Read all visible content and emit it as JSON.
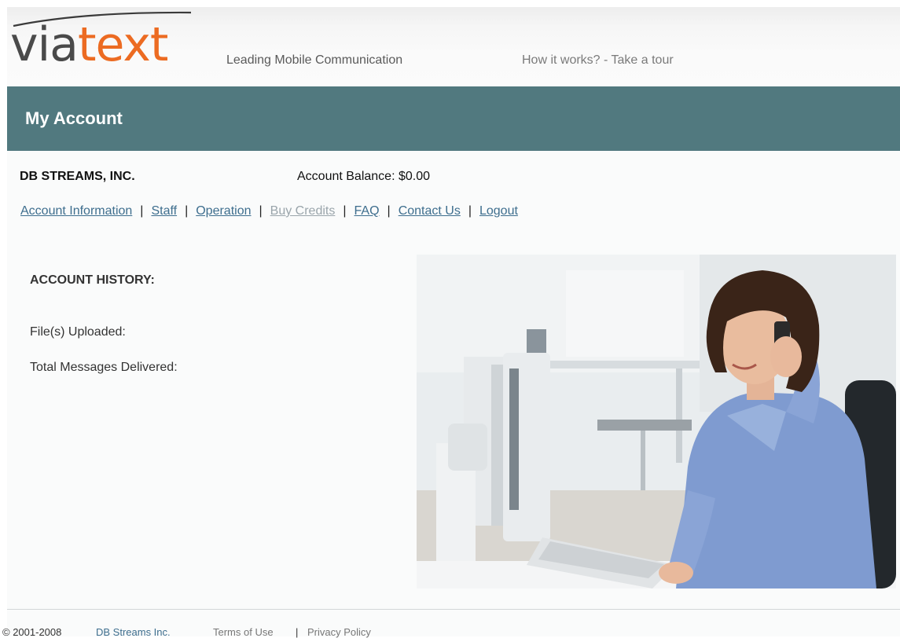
{
  "header": {
    "logo_part1": "via",
    "logo_part2": "text",
    "tagline": "Leading Mobile Communication",
    "tour_link": "How it works? - Take a tour"
  },
  "banner": {
    "title": "My Account"
  },
  "account": {
    "company": "DB STREAMS, INC.",
    "balance": "Account Balance: $0.00"
  },
  "nav": {
    "items": [
      {
        "label": "Account Information",
        "enabled": true
      },
      {
        "label": "Staff",
        "enabled": true
      },
      {
        "label": "Operation",
        "enabled": true
      },
      {
        "label": "Buy Credits",
        "enabled": false
      },
      {
        "label": "FAQ",
        "enabled": true
      },
      {
        "label": "Contact Us",
        "enabled": true
      },
      {
        "label": "Logout",
        "enabled": true
      }
    ],
    "separator": "|"
  },
  "history": {
    "title": "ACCOUNT HISTORY:",
    "files_uploaded": "File(s) Uploaded:",
    "messages_delivered": "Total Messages Delivered:"
  },
  "footer": {
    "copyright": "© 2001-2008",
    "company_link": "DB Streams Inc.",
    "terms": "Terms of Use",
    "separator": "|",
    "privacy": "Privacy Policy"
  },
  "colors": {
    "banner": "#51797f",
    "logo_orange": "#ec6b22",
    "logo_gray": "#4a4a4a",
    "link": "#3e6e8e"
  }
}
